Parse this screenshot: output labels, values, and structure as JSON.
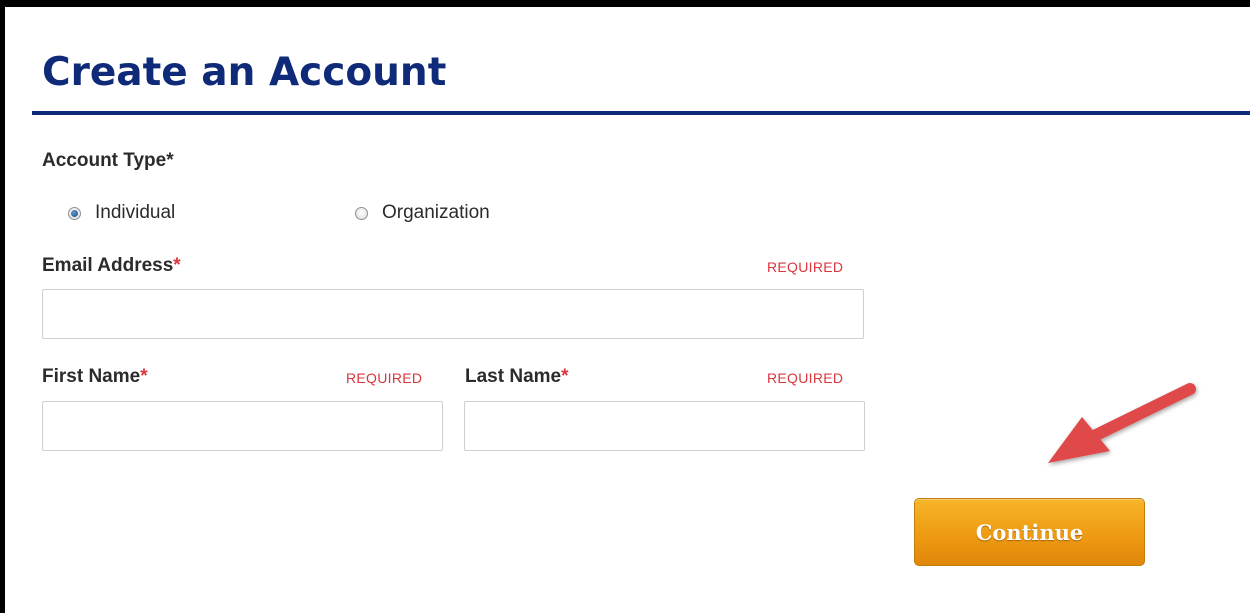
{
  "page": {
    "title": "Create an Account"
  },
  "account_type": {
    "label": "Account Type",
    "asterisk": "*",
    "options": [
      {
        "label": "Individual",
        "selected": true
      },
      {
        "label": "Organization",
        "selected": false
      }
    ]
  },
  "form": {
    "email": {
      "label": "Email Address",
      "asterisk": "*",
      "required_text": "REQUIRED",
      "value": "",
      "placeholder": ""
    },
    "first_name": {
      "label": "First Name",
      "asterisk": "*",
      "required_text": "REQUIRED",
      "value": "",
      "placeholder": ""
    },
    "last_name": {
      "label": "Last Name",
      "asterisk": "*",
      "required_text": "REQUIRED",
      "value": "",
      "placeholder": ""
    }
  },
  "actions": {
    "continue_label": "Continue"
  },
  "annotation": {
    "icon": "red-arrow-pointing-to-continue",
    "color": "#e04848"
  },
  "colors": {
    "title": "#0f2a78",
    "required": "#d9363e",
    "button": "#f0a01a"
  }
}
